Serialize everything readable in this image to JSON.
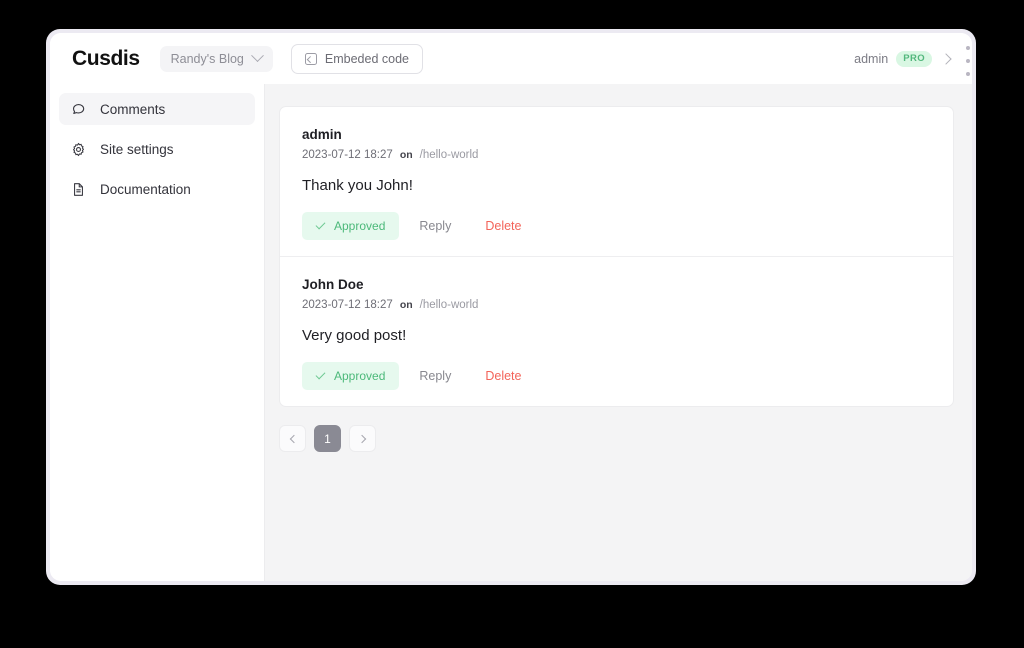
{
  "window": {
    "frame_handle_icon": "drag-dots-icon"
  },
  "header": {
    "brand": "Cusdis",
    "site_selector": {
      "label": "Randy's Blog",
      "icon": "chevron-down-icon"
    },
    "embed_button": {
      "label": "Embeded code",
      "icon": "code-square-icon"
    },
    "user": {
      "name": "admin",
      "badge": "PRO",
      "icon": "chevron-right-icon",
      "badge_bg": "#d9f7e3",
      "badge_color": "#52b77c"
    }
  },
  "sidebar": {
    "items": [
      {
        "label": "Comments",
        "icon": "chat-bubble-icon",
        "active": true
      },
      {
        "label": "Site settings",
        "icon": "gear-icon",
        "active": false
      },
      {
        "label": "Documentation",
        "icon": "document-icon",
        "active": false
      }
    ]
  },
  "main": {
    "comments": [
      {
        "author": "admin",
        "timestamp": "2023-07-12 18:27",
        "on_label": "on",
        "path": "/hello-world",
        "body": "Thank you John!",
        "actions": {
          "status": "Approved",
          "status_icon": "check-icon",
          "reply": "Reply",
          "delete": "Delete"
        }
      },
      {
        "author": "John Doe",
        "timestamp": "2023-07-12 18:27",
        "on_label": "on",
        "path": "/hello-world",
        "body": "Very good post!",
        "actions": {
          "status": "Approved",
          "status_icon": "check-icon",
          "reply": "Reply",
          "delete": "Delete"
        }
      }
    ],
    "pagination": {
      "prev_icon": "chevron-left-icon",
      "next_icon": "chevron-right-icon",
      "current_page": "1"
    }
  },
  "colors": {
    "approved_bg": "#e6f9ee",
    "approved_text": "#4cb97a",
    "delete_text": "#f3645a",
    "active_page_bg": "#8a8a94"
  }
}
